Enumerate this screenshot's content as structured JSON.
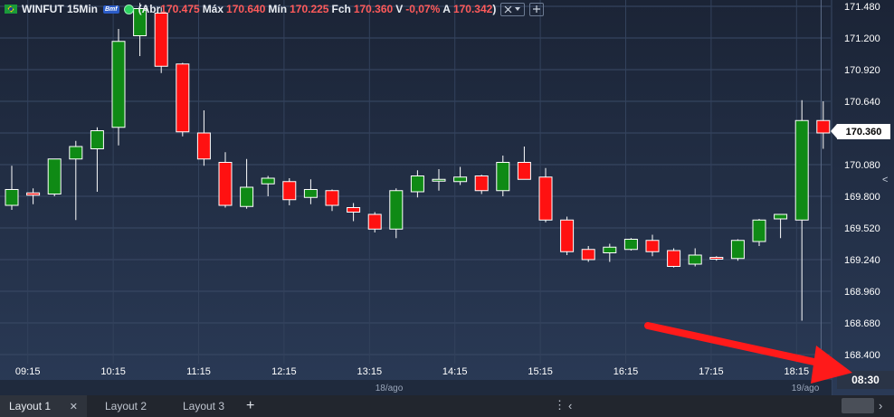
{
  "header": {
    "symbol": "WINFUT 15Min",
    "brand_badge": "Bmf",
    "ohlc": {
      "open_label": "Abr",
      "open_value": "170.475",
      "high_label": "Máx",
      "high_value": "170.640",
      "low_label": "Mín",
      "low_value": "170.225",
      "close_label": "Fch",
      "close_value": "170.360",
      "var_label": "V",
      "var_value": "-0,07%",
      "ask_label": "A",
      "ask_value": "170.342",
      "open_paren": "(",
      "close_paren": ")"
    },
    "tools_icon": "tools-icon",
    "dropdown_icon": "chevron-down-icon",
    "add_icon": "plus-icon"
  },
  "colors": {
    "background_top": "#1b2436",
    "background_bottom": "#2a3a56",
    "up": "#0f8a15",
    "down": "#ff1111",
    "axis_text": "#ffffff",
    "grid": "#3a4a66",
    "arrow": "#ff1a1a"
  },
  "price_axis": {
    "labels": [
      "171.480",
      "171.200",
      "170.920",
      "170.640",
      "170.360",
      "170.080",
      "169.800",
      "169.520",
      "169.240",
      "168.960",
      "168.680",
      "168.400"
    ],
    "current_price": "170.360"
  },
  "time_axis": {
    "labels": [
      "09:15",
      "10:15",
      "11:15",
      "12:15",
      "13:15",
      "14:15",
      "15:15",
      "16:15",
      "17:15",
      "18:15"
    ],
    "date_labels": [
      "18/ago",
      "19/ago"
    ],
    "current_time": "08:30"
  },
  "chart_data": {
    "type": "candlestick",
    "ylim": [
      168.28,
      171.51
    ],
    "candles": [
      {
        "o": 169.72,
        "h": 170.07,
        "l": 169.68,
        "c": 169.86
      },
      {
        "o": 169.83,
        "h": 169.87,
        "l": 169.73,
        "c": 169.81
      },
      {
        "o": 169.82,
        "h": 170.13,
        "l": 169.8,
        "c": 170.13
      },
      {
        "o": 170.13,
        "h": 170.29,
        "l": 169.59,
        "c": 170.24
      },
      {
        "o": 170.22,
        "h": 170.41,
        "l": 169.84,
        "c": 170.38
      },
      {
        "o": 170.41,
        "h": 171.28,
        "l": 170.25,
        "c": 171.17
      },
      {
        "o": 171.22,
        "h": 171.51,
        "l": 171.04,
        "c": 171.46
      },
      {
        "o": 171.42,
        "h": 171.47,
        "l": 170.89,
        "c": 170.95
      },
      {
        "o": 170.97,
        "h": 170.98,
        "l": 170.33,
        "c": 170.37
      },
      {
        "o": 170.36,
        "h": 170.56,
        "l": 170.07,
        "c": 170.13
      },
      {
        "o": 170.1,
        "h": 170.19,
        "l": 169.7,
        "c": 169.72
      },
      {
        "o": 169.71,
        "h": 170.13,
        "l": 169.69,
        "c": 169.88
      },
      {
        "o": 169.91,
        "h": 169.98,
        "l": 169.8,
        "c": 169.96
      },
      {
        "o": 169.93,
        "h": 169.96,
        "l": 169.72,
        "c": 169.77
      },
      {
        "o": 169.79,
        "h": 169.95,
        "l": 169.73,
        "c": 169.86
      },
      {
        "o": 169.85,
        "h": 169.86,
        "l": 169.67,
        "c": 169.72
      },
      {
        "o": 169.7,
        "h": 169.74,
        "l": 169.58,
        "c": 169.66
      },
      {
        "o": 169.64,
        "h": 169.66,
        "l": 169.48,
        "c": 169.51
      },
      {
        "o": 169.51,
        "h": 169.87,
        "l": 169.43,
        "c": 169.85
      },
      {
        "o": 169.84,
        "h": 170.03,
        "l": 169.79,
        "c": 169.98
      },
      {
        "o": 169.94,
        "h": 170.04,
        "l": 169.85,
        "c": 169.95
      },
      {
        "o": 169.93,
        "h": 170.06,
        "l": 169.9,
        "c": 169.97
      },
      {
        "o": 169.98,
        "h": 169.99,
        "l": 169.82,
        "c": 169.85
      },
      {
        "o": 169.85,
        "h": 170.16,
        "l": 169.8,
        "c": 170.1
      },
      {
        "o": 170.1,
        "h": 170.24,
        "l": 169.97,
        "c": 169.95
      },
      {
        "o": 169.97,
        "h": 170.05,
        "l": 169.57,
        "c": 169.59
      },
      {
        "o": 169.59,
        "h": 169.62,
        "l": 169.28,
        "c": 169.31
      },
      {
        "o": 169.33,
        "h": 169.36,
        "l": 169.22,
        "c": 169.24
      },
      {
        "o": 169.3,
        "h": 169.38,
        "l": 169.22,
        "c": 169.35
      },
      {
        "o": 169.33,
        "h": 169.43,
        "l": 169.32,
        "c": 169.42
      },
      {
        "o": 169.41,
        "h": 169.46,
        "l": 169.27,
        "c": 169.31
      },
      {
        "o": 169.32,
        "h": 169.34,
        "l": 169.17,
        "c": 169.18
      },
      {
        "o": 169.2,
        "h": 169.34,
        "l": 169.18,
        "c": 169.28
      },
      {
        "o": 169.26,
        "h": 169.27,
        "l": 169.23,
        "c": 169.25
      },
      {
        "o": 169.25,
        "h": 169.42,
        "l": 169.23,
        "c": 169.41
      },
      {
        "o": 169.4,
        "h": 169.6,
        "l": 169.36,
        "c": 169.59
      },
      {
        "o": 169.6,
        "h": 169.62,
        "l": 169.43,
        "c": 169.64
      },
      {
        "o": 169.59,
        "h": 170.65,
        "l": 168.7,
        "c": 170.47
      },
      {
        "o": 170.47,
        "h": 170.64,
        "l": 170.22,
        "c": 170.36
      }
    ]
  },
  "tabs": [
    {
      "label": "Layout 1",
      "close": "✕"
    },
    {
      "label": "Layout 2"
    },
    {
      "label": "Layout 3"
    }
  ],
  "tab_add": "+",
  "nav": {
    "menu": "⋮",
    "left": "‹",
    "right": "›",
    "collapse": "<"
  }
}
